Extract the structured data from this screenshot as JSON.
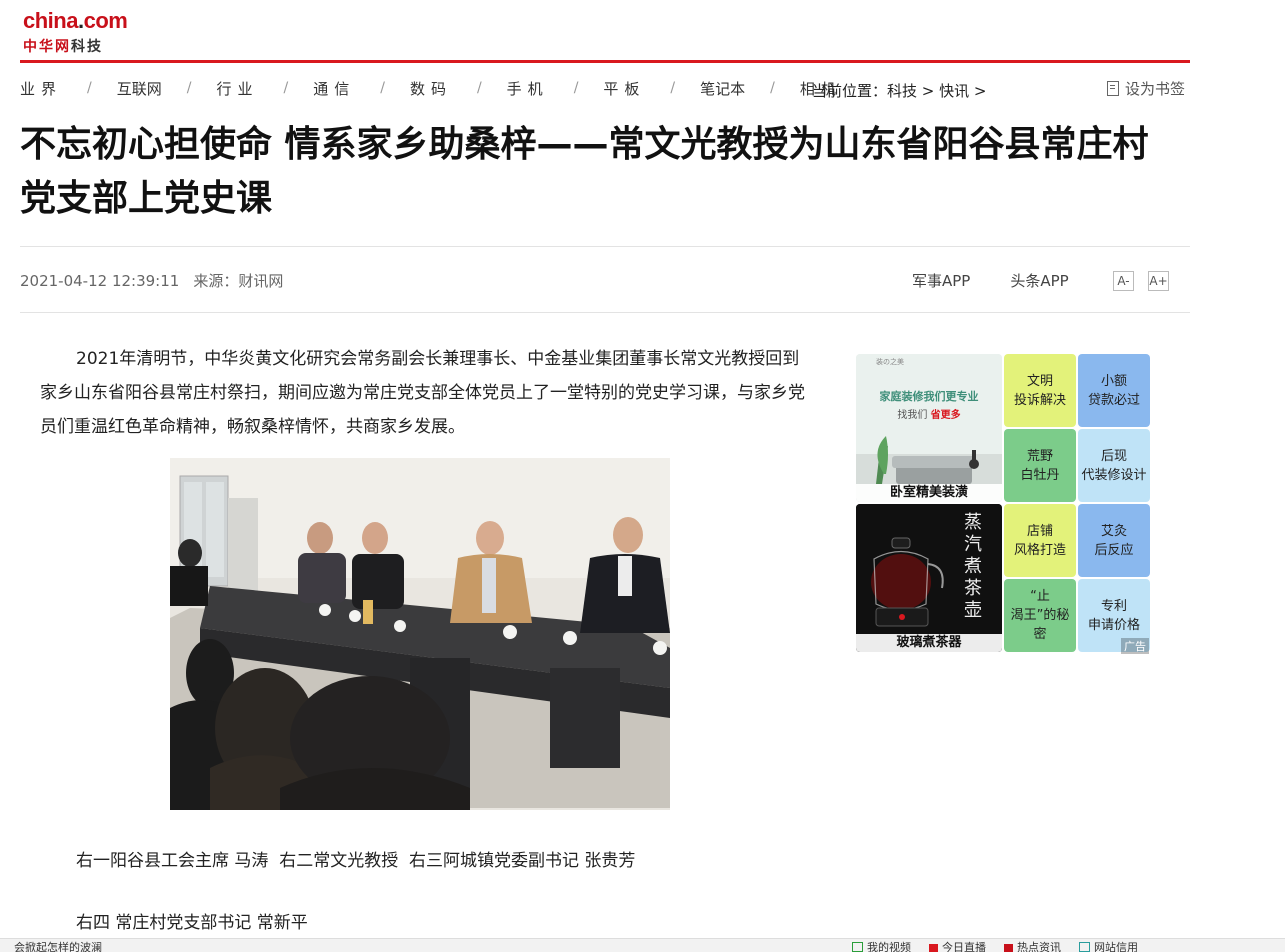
{
  "header": {
    "logo_en_a": "china",
    "logo_en_dot": ".",
    "logo_en_b": "com",
    "logo_cn_a": "中华网",
    "logo_cn_b": "科技",
    "brand_color": "#d9181f"
  },
  "nav": {
    "items": [
      "业界",
      "互联网",
      "行业",
      "通信",
      "数码",
      "手机",
      "平板",
      "笔记本",
      "相机"
    ],
    "separator": "/",
    "breadcrumb": "当前位置：科技 > 快讯 >",
    "bookmark": "设为书签"
  },
  "article": {
    "title": "不忘初心担使命 情系家乡助桑梓——常文光教授为山东省阳谷县常庄村党支部上党史课",
    "datetime": "2021-04-12 12:39:11",
    "source": "来源：财讯网",
    "app_links": [
      "军事APP",
      "头条APP"
    ],
    "font_smaller": "A-",
    "font_larger": "A+",
    "paragraph": "2021年清明节，中华炎黄文化研究会常务副会长兼理事长、中金基业集团董事长常文光教授回到家乡山东省阳谷县常庄村祭扫，期间应邀为常庄党支部全体党员上了一堂特别的党史学习课，与家乡党员们重温红色革命精神，畅叙桑梓情怀，共商家乡发展。",
    "caption1": "右一阳谷县工会主席 马涛  右二常文光教授  右三阿城镇党委副书记 张贵芳",
    "caption2": "右四 常庄村党支部书记 常新平"
  },
  "ad": {
    "img1_heading": "家庭装修我们更专业",
    "img1_sub_a": "找我们",
    "img1_sub_b": "省更多",
    "img1_small": "装の之美",
    "img1_label": "卧室精美装潢",
    "img2_vertical_text": "蒸汽煮茶壶",
    "img2_label": "玻璃煮茶器",
    "cells": [
      {
        "text": "文明\n投诉解决",
        "color": "#e3f27a"
      },
      {
        "text": "小额\n贷款必过",
        "color": "#8ab8ee"
      },
      {
        "text": "荒野\n白牡丹",
        "color": "#7ccc8a"
      },
      {
        "text": "后现\n代装修设计",
        "color": "#bfe3f7"
      },
      {
        "text": "店铺\n风格打造",
        "color": "#e3f27a"
      },
      {
        "text": "艾灸\n后反应",
        "color": "#8ab8ee"
      },
      {
        "text": "“止\n渴王”的秘\n密",
        "color": "#7ccc8a"
      },
      {
        "text": "专利\n申请价格",
        "color": "#bfe3f7"
      }
    ],
    "tag": "广告"
  },
  "bottombar": {
    "left": "会掀起怎样的波澜",
    "right": [
      "我的视频",
      "今日直播",
      "热点资讯",
      "网站信用"
    ]
  }
}
